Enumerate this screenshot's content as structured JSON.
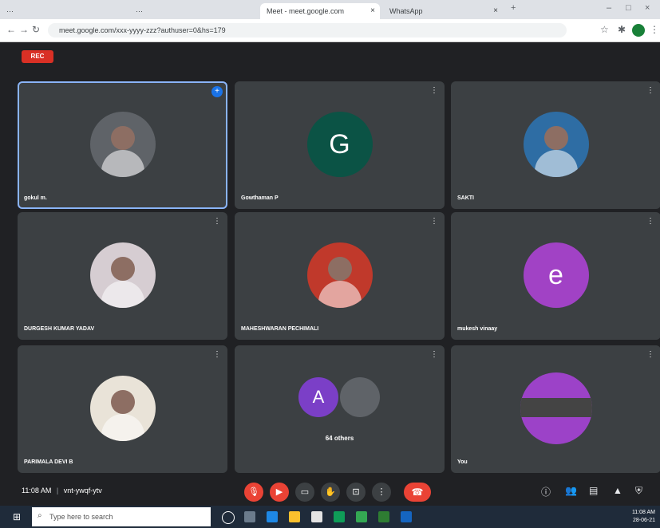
{
  "browser": {
    "tabs": [
      {
        "label": "Meet - meet.google.com",
        "active": true
      },
      {
        "label": "WhatsApp",
        "active": false
      }
    ],
    "url": "meet.google.com/xxx-yyyy-zzz?authuser=0&hs=179",
    "new_tab": "+",
    "window_controls": [
      "–",
      "□",
      "×"
    ]
  },
  "meet": {
    "rec_label": "REC",
    "participants": [
      {
        "name": "gokul m.",
        "avatar": "photo",
        "color": "#5f6368"
      },
      {
        "name": "Gowthaman P",
        "avatar": "letter",
        "letter": "G",
        "color": "#0b5345"
      },
      {
        "name": "SAKTI",
        "avatar": "photo",
        "color": "#2e6da4"
      },
      {
        "name": "DURGESH KUMAR YADAV",
        "avatar": "photo",
        "color": "#d6cdd2"
      },
      {
        "name": "MAHESHWARAN PECHIMALI",
        "avatar": "photo",
        "color": "#c0392b"
      },
      {
        "name": "mukesh vinaay",
        "avatar": "letter",
        "letter": "e",
        "color": "#a142c5"
      },
      {
        "name": "PARIMALA DEVI B",
        "avatar": "photo",
        "color": "#e9e3d8"
      },
      {
        "name": "64 others",
        "avatar": "group",
        "letter": "A",
        "color": "#7b3fc7"
      },
      {
        "name": "You",
        "avatar": "self",
        "color": "#9c42c8"
      }
    ],
    "time": "11:08 AM",
    "meeting_code": "vnt-ywqf-ytv"
  },
  "taskbar": {
    "search_placeholder": "Type here to search",
    "clock_time": "11:08 AM",
    "clock_date": "28-06-21"
  }
}
